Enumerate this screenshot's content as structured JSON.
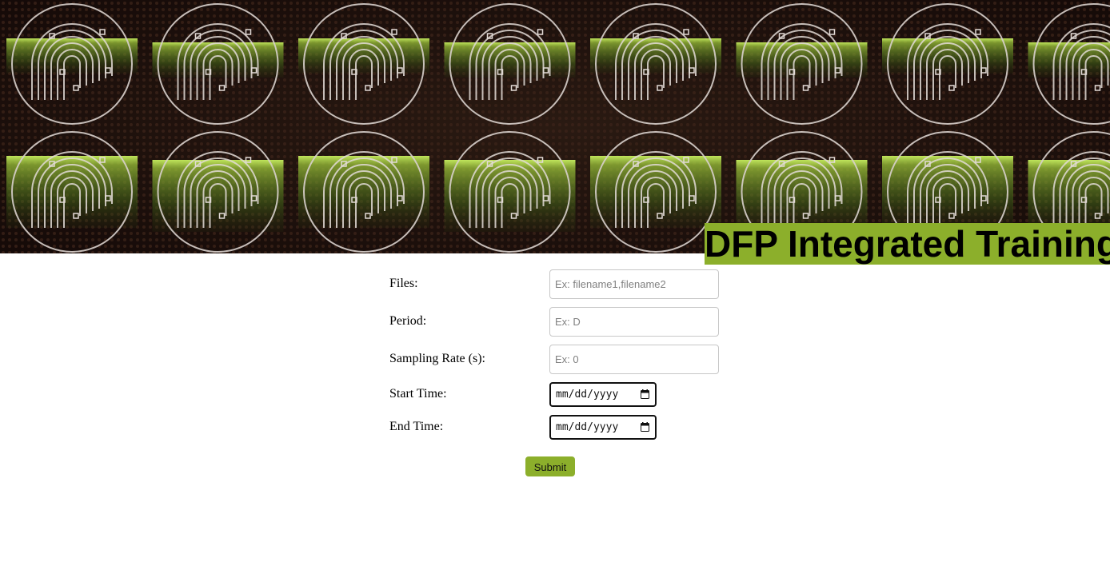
{
  "header": {
    "title": "DFP Integrated Training",
    "banner_icon": "fingerprint-icon",
    "accent_color": "#8caf2b"
  },
  "form": {
    "files": {
      "label": "Files:",
      "placeholder": "Ex: filename1,filename2",
      "value": ""
    },
    "period": {
      "label": "Period:",
      "placeholder": "Ex: D",
      "value": ""
    },
    "sampling_rate": {
      "label": "Sampling Rate (s):",
      "placeholder": "Ex: 0",
      "value": ""
    },
    "start_time": {
      "label": "Start Time:",
      "value": "mm/dd/yyyy",
      "icon": "calendar-icon"
    },
    "end_time": {
      "label": "End Time:",
      "value": "mm/dd/yyyy",
      "icon": "calendar-icon"
    },
    "submit_label": "Submit"
  }
}
